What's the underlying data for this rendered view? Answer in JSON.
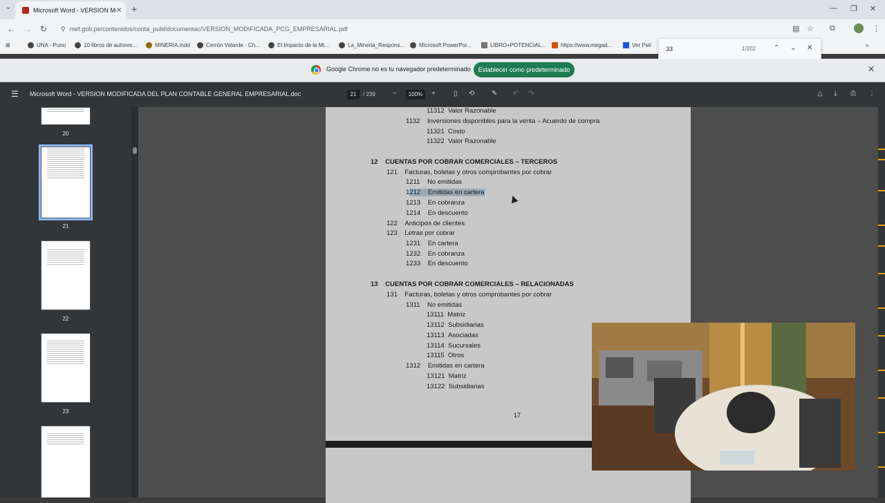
{
  "browser": {
    "tab_title": "Microsoft Word - VERSION MO",
    "tab_close": "✕",
    "new_tab": "+",
    "url": "mef.gob.pe/contenidos/conta_publ/documentac/VERSION_MODIFICADA_PCG_EMPRESARIAL.pdf",
    "bookmarks": [
      "UNA - Puno",
      "10 libros de autores...",
      "MINERIA.indd",
      "Cerrón Velarde - Ch...",
      "El Impacto de la Mi...",
      "La_Mineria_Respons...",
      "Microsoft PowerPoi...",
      "LIBRO+POTENCIAL...",
      "https://www.megad...",
      "Ver Pelí"
    ]
  },
  "find_bar": {
    "query": "33",
    "count": "1/202"
  },
  "infobar": {
    "message": "Google Chrome no es tu navegador predeterminado",
    "button": "Establecer como predeterminado"
  },
  "pdf_toolbar": {
    "title": "Microsoft Word - VERSION MODIFICADA DEL PLAN CONTABLE GENERAL EMPRESARIAL.doc",
    "current_page": "21",
    "total_pages": "/ 239",
    "zoom": "100%"
  },
  "thumbnails": [
    "20",
    "21",
    "22",
    "23"
  ],
  "document": {
    "lines": [
      {
        "code": "11312",
        "text": "Valor Razonable"
      },
      {
        "code": "1132",
        "text": "Inversiones disponibles para la venta – Acuerdo de compra"
      },
      {
        "code": "11321",
        "text": "Costo"
      },
      {
        "code": "11322",
        "text": "Valor Razonable"
      },
      {
        "code": "12",
        "text": "CUENTAS POR COBRAR COMERCIALES – TERCEROS"
      },
      {
        "code": "121",
        "text": "Facturas, boletas y otros comprobantes por cobrar"
      },
      {
        "code": "1211",
        "text": "No emitidas"
      },
      {
        "code_pre": "1",
        "code_hl": "212",
        "text": "Emitidas en cartera"
      },
      {
        "code": "1213",
        "text": "En cobranza"
      },
      {
        "code": "1214",
        "text": "En descuento"
      },
      {
        "code": "122",
        "text": "Anticipos de clientes"
      },
      {
        "code": "123",
        "text": "Letras por cobrar"
      },
      {
        "code": "1231",
        "text": "En cartera"
      },
      {
        "code": "1232",
        "text": "En cobranza"
      },
      {
        "code": "1233",
        "text": "En descuento"
      },
      {
        "code": "13",
        "text": "CUENTAS POR COBRAR COMERCIALES – RELACIONADAS"
      },
      {
        "code": "131",
        "text": "Facturas, boletas y otros comprobantes por cobrar"
      },
      {
        "code": "1311",
        "text": "No emitidas"
      },
      {
        "code": "13111",
        "text": "Matriz"
      },
      {
        "code": "13112",
        "text": "Subsidiarias"
      },
      {
        "code": "13113",
        "text": "Asociadas"
      },
      {
        "code": "13114",
        "text": "Sucursales"
      },
      {
        "code": "13115",
        "text": "Otros"
      },
      {
        "code": "1312",
        "text": "Emitidas en cartera"
      },
      {
        "code": "13121",
        "text": "Matriz"
      },
      {
        "code": "13122",
        "text": "Subsidiarias"
      }
    ],
    "page_number": "17"
  },
  "icons": [
    "menu-icon",
    "back-icon",
    "forward-icon",
    "reload-icon",
    "star-icon",
    "download-icon",
    "print-icon"
  ]
}
